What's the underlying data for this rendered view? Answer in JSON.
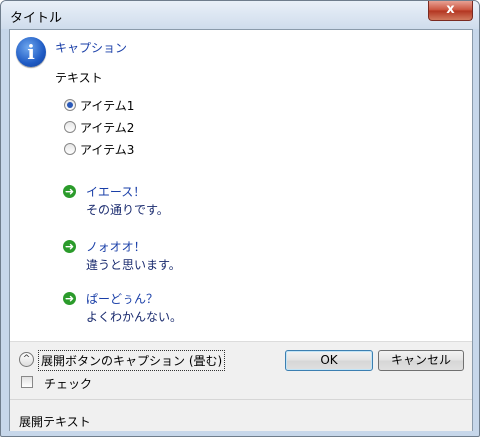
{
  "window": {
    "title": "タイトル",
    "close_label": "x"
  },
  "main": {
    "icon_char": "i",
    "caption": "キャプション",
    "text": "テキスト",
    "radios": [
      {
        "label": "アイテム1",
        "checked": true
      },
      {
        "label": "アイテム2",
        "checked": false
      },
      {
        "label": "アイテム3",
        "checked": false
      }
    ],
    "command_links": [
      {
        "title": "イエース！",
        "note": "その通りです。"
      },
      {
        "title": "ノォオオ！",
        "note": "違うと思います。"
      },
      {
        "title": "ぱーどぅん？",
        "note": "よくわかんない。"
      }
    ]
  },
  "footer": {
    "expand_icon": "^",
    "expand_label": "展開ボタンのキャプション (畳む)",
    "checkbox_label": "チェック",
    "ok_label": "OK",
    "cancel_label": "キャンセル",
    "expanded_text": "展開テキスト"
  },
  "colors": {
    "caption": "#1a3fa8",
    "command_arrow": "#2b9b2b",
    "footer_bg": "#f0f0f0"
  }
}
